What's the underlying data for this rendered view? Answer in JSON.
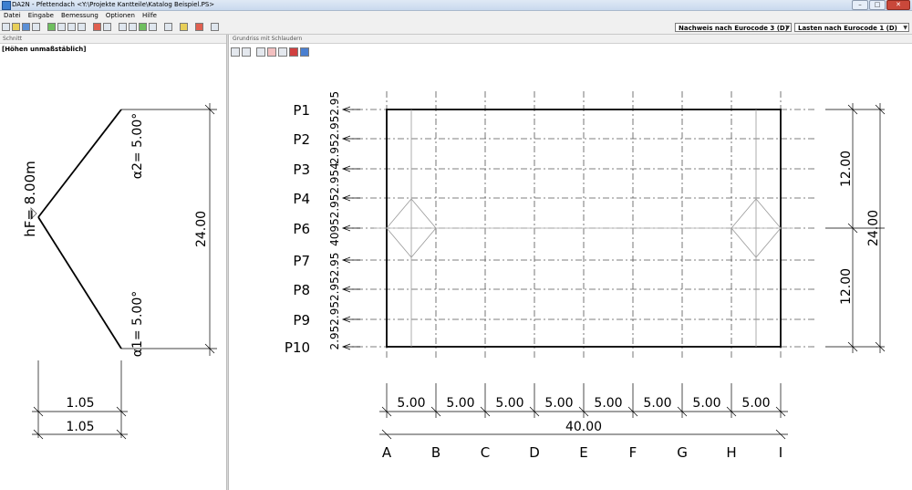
{
  "window": {
    "title": "DA2N - Pfettendach <Y:\\Projekte Kantteile\\Katalog Beispiel.PS>"
  },
  "menu": [
    "Datei",
    "Eingabe",
    "Bemessung",
    "Optionen",
    "Hilfe"
  ],
  "toolbar": {
    "dropdown_code": "Nachweis nach Eurocode 3 (D)",
    "dropdown_loads": "Lasten nach Eurocode 1 (D)"
  },
  "section_panel": {
    "title": "Schnitt",
    "note": "[Höhen unmaßstäblich]",
    "ridge_height": "hF= 8.00m",
    "angle_top": "α2= 5.00°",
    "angle_bottom": "α1= 5.00°",
    "total_dim": "24.00",
    "bottom_dim_1": "1.05",
    "bottom_dim_2": "1.05"
  },
  "plan_panel": {
    "title": "Grundriss mit Schlaudern",
    "rows": [
      "P1",
      "P2",
      "P3",
      "P4",
      "P6",
      "P7",
      "P8",
      "P9",
      "P10"
    ],
    "row_spacing_label_top": "2.952.952.95",
    "row_spacing_label_mid": "40952.952.954",
    "row_spacing_label_bottom": "2.952.952.952.95",
    "columns": [
      "A",
      "B",
      "C",
      "D",
      "E",
      "F",
      "G",
      "H",
      "I"
    ],
    "column_spacings": [
      "5.00",
      "5.00",
      "5.00",
      "5.00",
      "5.00",
      "5.00",
      "5.00",
      "5.00"
    ],
    "total_length": "40.00",
    "right_dim_top": "12.00",
    "right_dim_total": "24.00",
    "right_dim_bottom": "12.00"
  }
}
